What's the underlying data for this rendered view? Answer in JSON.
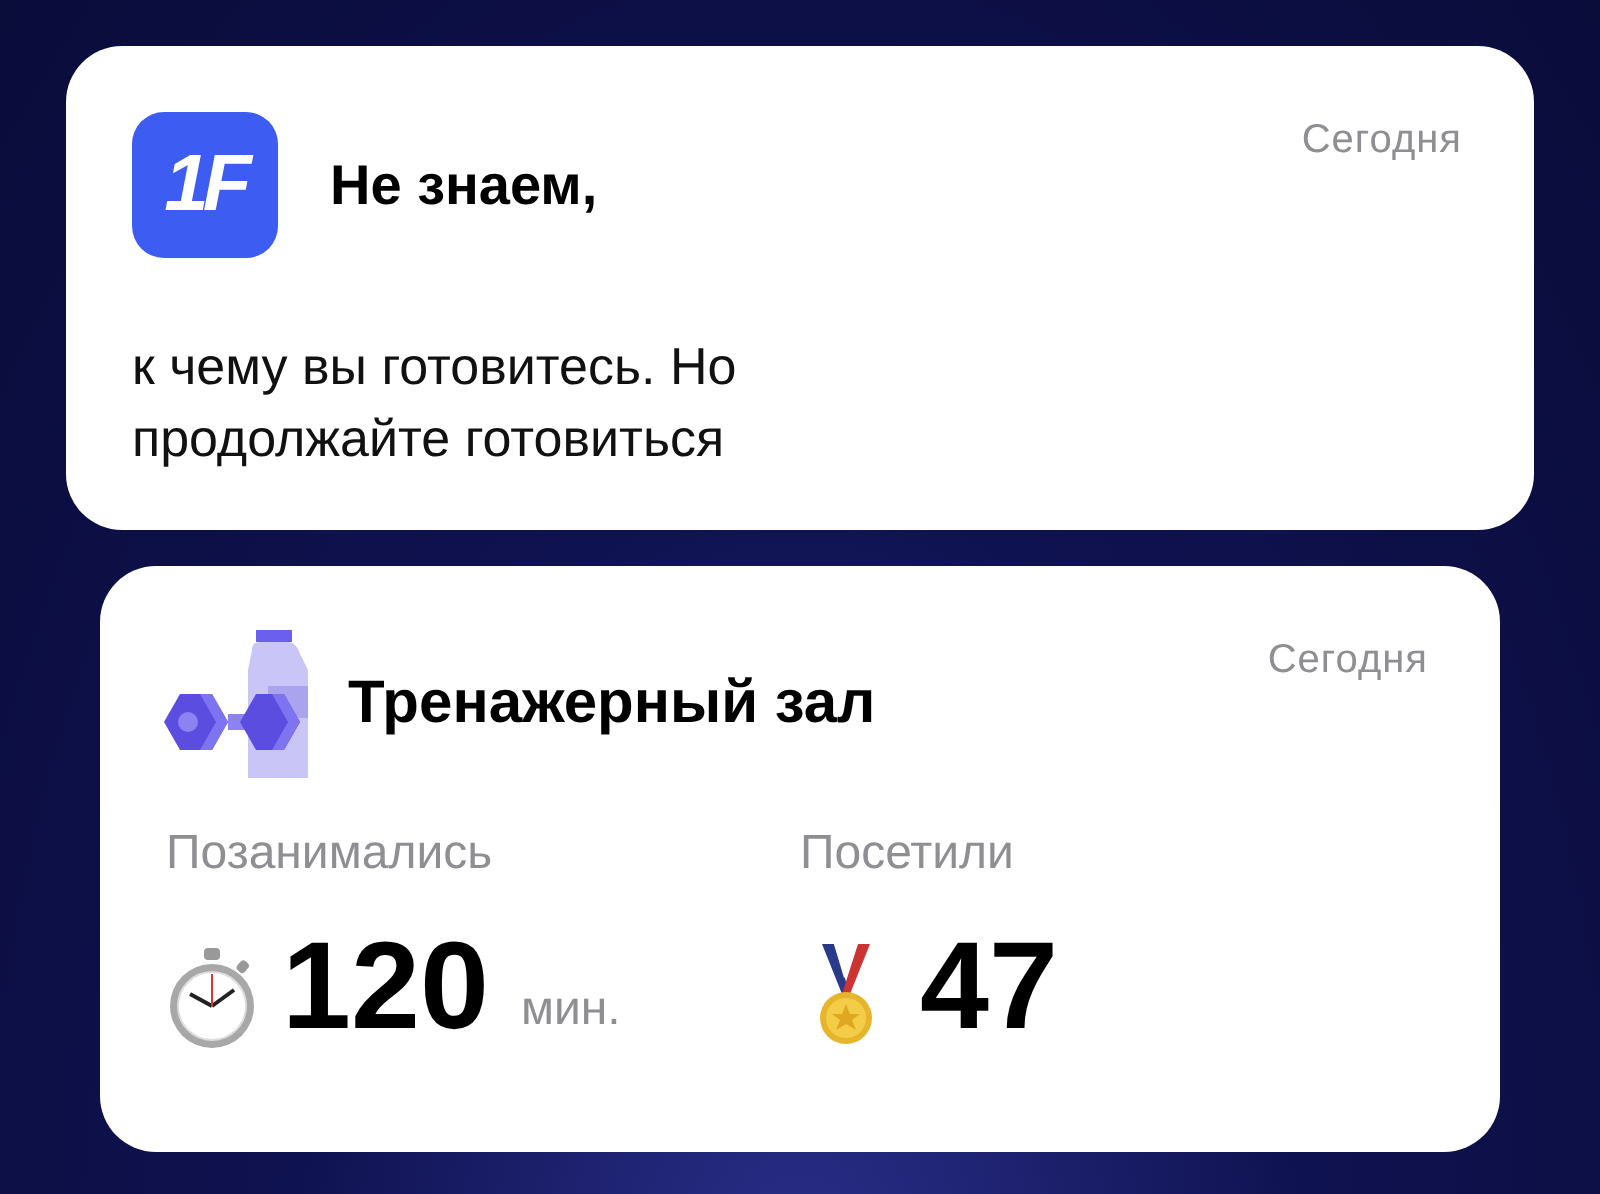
{
  "notifications": [
    {
      "kind": "app",
      "logo": "1F",
      "title": "Не знаем,",
      "time": "Сегодня",
      "body": "к чему вы готовитесь. Но продолжайте готовиться"
    },
    {
      "kind": "gym",
      "title": "Тренажерный зал",
      "time": "Сегодня",
      "stats": [
        {
          "kind": "timer",
          "label": "Позанимались",
          "value": "120",
          "unit": "мин."
        },
        {
          "kind": "medal",
          "label": "Посетили",
          "value": "47"
        }
      ]
    }
  ]
}
